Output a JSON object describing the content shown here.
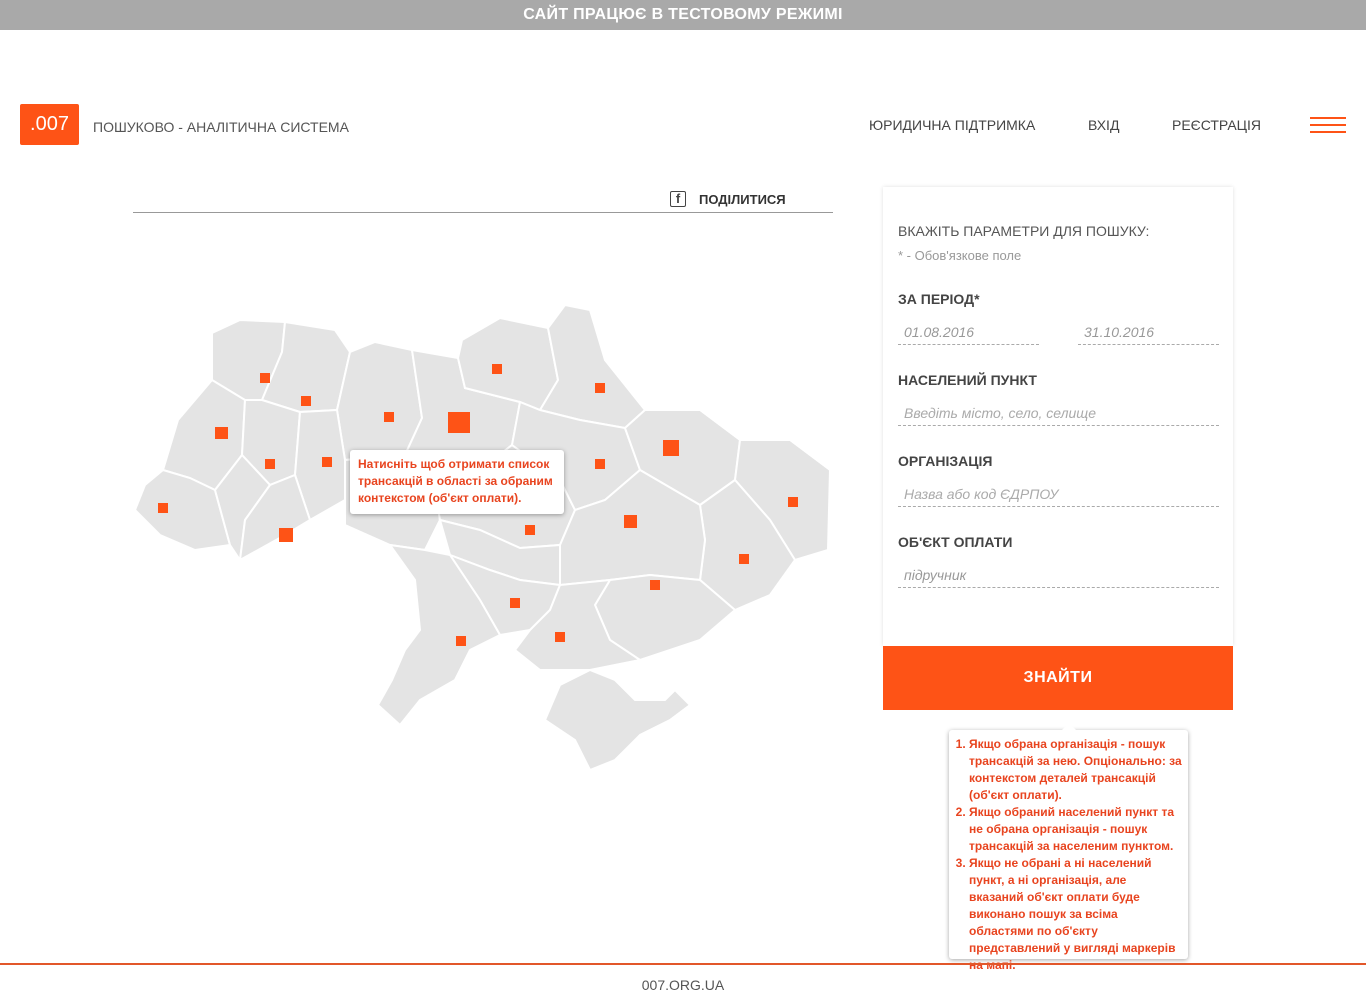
{
  "banner": "САЙТ ПРАЦЮЄ В ТЕСТОВОМУ РЕЖИМІ",
  "header": {
    "logo": ".007",
    "tagline": "ПОШУКОВО - АНАЛІТИЧНА СИСТЕМА",
    "nav": {
      "legal": "ЮРИДИЧНА ПІДТРИМКА",
      "login": "ВХІД",
      "register": "РЕЄСТРАЦІЯ"
    }
  },
  "share": {
    "icon": "facebook-icon",
    "label": "ПОДІЛИТИСЯ"
  },
  "map_tooltip": "Натисніть щоб отримати список трансакцій в області за обраним контекстом (об'єкт оплати).",
  "search": {
    "title": "ВКАЖІТЬ ПАРАМЕТРИ ДЛЯ ПОШУКУ:",
    "required_note": "* - Обов'язкове поле",
    "period_label": "ЗА ПЕРІОД*",
    "date_from": "01.08.2016",
    "date_to": "31.10.2016",
    "locality_label": "НАСЕЛЕНИЙ ПУНКТ",
    "locality_placeholder": "Введіть місто, село, селище",
    "org_label": "ОРГАНІЗАЦІЯ",
    "org_placeholder": "Назва або код ЄДРПОУ",
    "object_label": "ОБ'ЄКТ ОПЛАТИ",
    "object_value": "підручник",
    "button": "ЗНАЙТИ"
  },
  "help": [
    "Якщо обрана організація - пошук трансакцій за нею. Опціонально: за контекстом деталей трансакцій (об'єкт оплати).",
    "Якщо обраний населений пункт та не обрана організація - пошук трансакцій за населеним пунктом.",
    "Якщо не обрані а ні населений пункт, а ні організація, але вказаний об'єкт оплати буде виконано пошук за всіма областями по об'єкту представлений у вигляді маркерів на мапі."
  ],
  "footer": "007.ORG.UA",
  "colors": {
    "accent": "#fe5316",
    "banner": "#a9a9a9",
    "region": "#e4e4e4"
  }
}
